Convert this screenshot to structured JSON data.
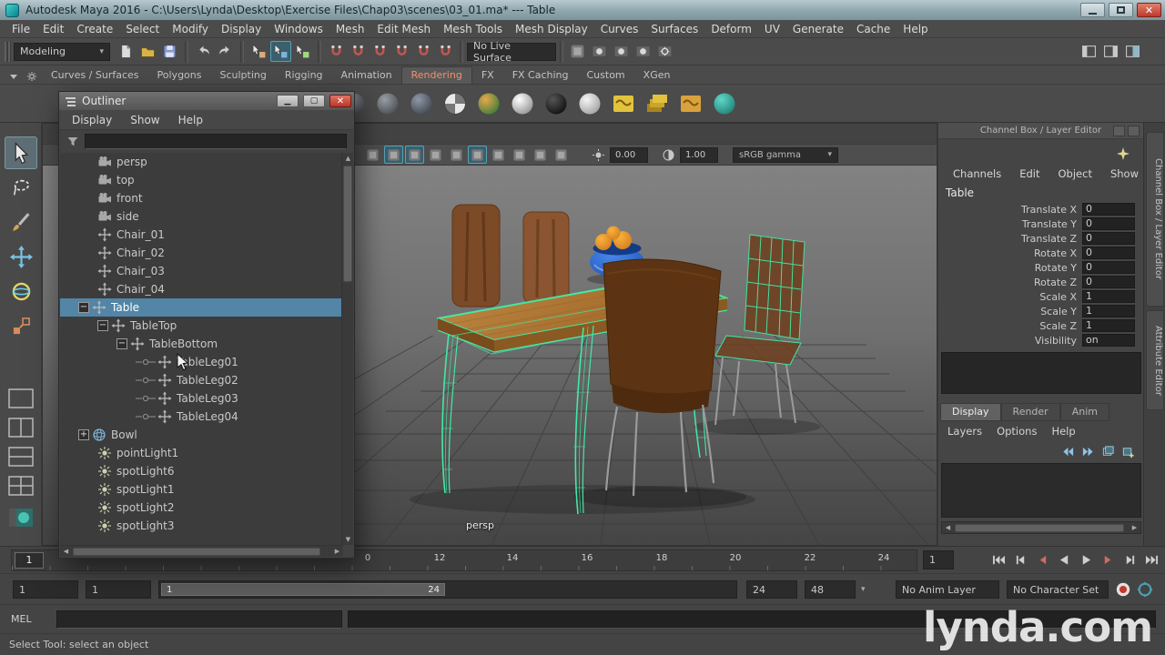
{
  "titlebar": {
    "title": "Autodesk Maya 2016 - C:\\Users\\Lynda\\Desktop\\Exercise Files\\Chap03\\scenes\\03_01.ma*  ---  Table"
  },
  "menubar": {
    "items": [
      "File",
      "Edit",
      "Create",
      "Select",
      "Modify",
      "Display",
      "Windows",
      "Mesh",
      "Edit Mesh",
      "Mesh Tools",
      "Mesh Display",
      "Curves",
      "Surfaces",
      "Deform",
      "UV",
      "Generate",
      "Cache",
      "Help"
    ]
  },
  "statusline": {
    "menuset": "Modeling",
    "live_surface": "No Live Surface",
    "groups_left": [
      [
        "new-scene-icon",
        "open-scene-icon",
        "save-scene-icon"
      ],
      [
        "undo-icon",
        "redo-icon"
      ],
      [
        "select-hierarchy-icon",
        "select-object-icon",
        "select-component-icon"
      ],
      [
        "snap-to-grid-icon",
        "snap-to-curve-icon",
        "snap-to-point-icon",
        "snap-to-projected-center-icon",
        "snap-to-view-plane-icon",
        "make-live-icon"
      ]
    ],
    "groups_right": [
      [
        "construction-history-icon",
        "open-render-view-icon",
        "render-current-frame-icon",
        "ipr-render-icon",
        "render-settings-icon"
      ]
    ],
    "active_icons": [
      "select-object-icon"
    ],
    "right_icons": [
      "toggle-tool-settings-icon",
      "toggle-attribute-editor-icon",
      "toggle-channel-box-icon"
    ]
  },
  "shelf": {
    "tabs": [
      "Curves / Surfaces",
      "Polygons",
      "Sculpting",
      "Rigging",
      "Animation",
      "Rendering",
      "FX",
      "FX Caching",
      "Custom",
      "XGen"
    ],
    "active_tab": "Rendering",
    "icons": [
      "material-sphere-1-icon",
      "material-sphere-2-icon",
      "material-sphere-3-icon",
      "checker-sphere-icon",
      "shaded-sphere-icon",
      "glow-sphere-icon",
      "black-sphere-icon",
      "white-sphere-icon",
      "render-texture-icon",
      "render-layers-icon",
      "batch-render-icon",
      "paint-effects-icon"
    ]
  },
  "toolbox": {
    "tools": [
      "select-tool",
      "lasso-tool",
      "paint-selection-tool",
      "move-tool",
      "rotate-tool",
      "scale-tool"
    ],
    "active_tool": "select-tool",
    "layouts": [
      "single-pane-layout",
      "two-pane-side-by-side-layout",
      "two-pane-stacked-layout",
      "four-pane-layout",
      "persp-outliner-layout"
    ]
  },
  "outliner": {
    "title": "Outliner",
    "menus": [
      "Display",
      "Show",
      "Help"
    ],
    "items": [
      {
        "label": "persp",
        "icon": "camera",
        "depth": 1
      },
      {
        "label": "top",
        "icon": "camera",
        "depth": 1
      },
      {
        "label": "front",
        "icon": "camera",
        "depth": 1
      },
      {
        "label": "side",
        "icon": "camera",
        "depth": 1
      },
      {
        "label": "Chair_01",
        "icon": "transform",
        "depth": 1
      },
      {
        "label": "Chair_02",
        "icon": "transform",
        "depth": 1
      },
      {
        "label": "Chair_03",
        "icon": "transform",
        "depth": 1
      },
      {
        "label": "Chair_04",
        "icon": "transform",
        "depth": 1
      },
      {
        "label": "Table",
        "icon": "transform",
        "depth": 0,
        "expander": "minus",
        "selected": true
      },
      {
        "label": "TableTop",
        "icon": "transform",
        "depth": 1,
        "expander": "minus"
      },
      {
        "label": "TableBottom",
        "icon": "transform",
        "depth": 2,
        "expander": "minus"
      },
      {
        "label": "TableLeg01",
        "icon": "transform",
        "depth": 3,
        "connector": true
      },
      {
        "label": "TableLeg02",
        "icon": "transform",
        "depth": 3,
        "connector": true
      },
      {
        "label": "TableLeg03",
        "icon": "transform",
        "depth": 3,
        "connector": true
      },
      {
        "label": "TableLeg04",
        "icon": "transform",
        "depth": 3,
        "connector": true
      },
      {
        "label": "Bowl",
        "icon": "mesh",
        "depth": 0,
        "expander": "plus"
      },
      {
        "label": "pointLight1",
        "icon": "light",
        "depth": 1
      },
      {
        "label": "spotLight6",
        "icon": "light",
        "depth": 1
      },
      {
        "label": "spotLight1",
        "icon": "light",
        "depth": 1
      },
      {
        "label": "spotLight2",
        "icon": "light",
        "depth": 1
      },
      {
        "label": "spotLight3",
        "icon": "light",
        "depth": 1
      }
    ]
  },
  "viewport": {
    "toolbar_icons": [
      "wireframe-icon",
      "shaded-icon",
      "textured-icon",
      "use-all-lights-icon",
      "shadows-icon",
      "ambient-occlusion-icon",
      "anti-aliasing-icon",
      "two-d-pan-zoom-icon",
      "grease-pencil-icon",
      "isolate-select-icon"
    ],
    "active_icons": [
      "shaded-icon",
      "textured-icon",
      "ambient-occlusion-icon"
    ],
    "exposure": "0.00",
    "gamma": "1.00",
    "view_transform": "sRGB gamma",
    "camera_label": "persp"
  },
  "channelbox": {
    "panel_title": "Channel Box / Layer Editor",
    "menus": [
      "Channels",
      "Edit",
      "Object",
      "Show"
    ],
    "object_name": "Table",
    "attributes": [
      {
        "label": "Translate X",
        "value": "0"
      },
      {
        "label": "Translate Y",
        "value": "0"
      },
      {
        "label": "Translate Z",
        "value": "0"
      },
      {
        "label": "Rotate X",
        "value": "0"
      },
      {
        "label": "Rotate Y",
        "value": "0"
      },
      {
        "label": "Rotate Z",
        "value": "0"
      },
      {
        "label": "Scale X",
        "value": "1"
      },
      {
        "label": "Scale Y",
        "value": "1"
      },
      {
        "label": "Scale Z",
        "value": "1"
      },
      {
        "label": "Visibility",
        "value": "on"
      }
    ],
    "layer_tabs": [
      "Display",
      "Render",
      "Anim"
    ],
    "active_layer_tab": "Display",
    "layer_menus": [
      "Layers",
      "Options",
      "Help"
    ],
    "layer_icons": [
      "layer-prev-icon",
      "layer-next-icon",
      "add-empty-layer-icon",
      "add-layer-from-selected-icon"
    ]
  },
  "side_tabs": [
    "Channel Box / Layer Editor",
    "Attribute Editor"
  ],
  "timeline": {
    "indicator_frame": "1",
    "ticks": [
      "0",
      "12",
      "14",
      "16",
      "18",
      "20",
      "22",
      "24"
    ],
    "current_time": "1",
    "playback_buttons": [
      "go-to-start-icon",
      "step-back-frame-icon",
      "step-back-key-icon",
      "play-backwards-icon",
      "play-forwards-icon",
      "step-forward-key-icon",
      "step-forward-frame-icon",
      "go-to-end-icon"
    ]
  },
  "range_slider": {
    "animation_start": "1",
    "playback_start": "1",
    "range_start": "1",
    "range_end": "24",
    "playback_end": "24",
    "animation_end": "48",
    "anim_layer": "No Anim Layer",
    "character_set": "No Character Set",
    "buttons": [
      "auto-keyframe-icon",
      "animation-preferences-icon"
    ]
  },
  "command_line": {
    "label": "MEL",
    "input_value": "",
    "result_value": ""
  },
  "help_line": {
    "text": "Select Tool: select an object"
  },
  "watermark": "lynda.com",
  "colors": {
    "selection_highlight": "#5285a6",
    "wireframe_selected_green": "#43e8a6",
    "active_shelf_tab_text": "#f2906f",
    "titlebar_top": "#b7c9cf",
    "close_button_red": "#c0392b"
  }
}
